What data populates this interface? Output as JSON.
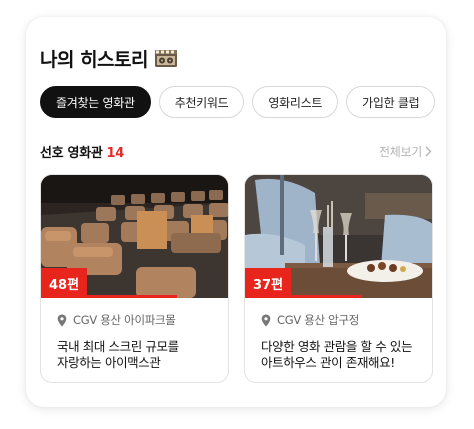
{
  "header": {
    "title": "나의 히스토리",
    "title_icon": "film-reel-icon"
  },
  "chips": [
    {
      "label": "즐겨찾는 영화관",
      "active": true
    },
    {
      "label": "추천키워드",
      "active": false
    },
    {
      "label": "영화리스트",
      "active": false
    },
    {
      "label": "가입한 클럽",
      "active": false
    }
  ],
  "section": {
    "title": "선호 영화관",
    "count": "14",
    "view_all": "전체보기"
  },
  "theaters": [
    {
      "badge": "48편",
      "progress": 0.72,
      "location": "CGV 용산 아이파크몰",
      "description_lines": [
        "국내 최대 스크린 규모를",
        "자랑하는 아이맥스관"
      ]
    },
    {
      "badge": "37편",
      "progress": 0.62,
      "location": "CGV 용산 압구정",
      "description_lines": [
        "다양한 영화 관람을 할 수 있는",
        "아트하우스 관이 존재해요!"
      ]
    }
  ],
  "colors": {
    "accent": "#e8251c",
    "chip_active_bg": "#111111",
    "muted": "#b5b5b5"
  }
}
